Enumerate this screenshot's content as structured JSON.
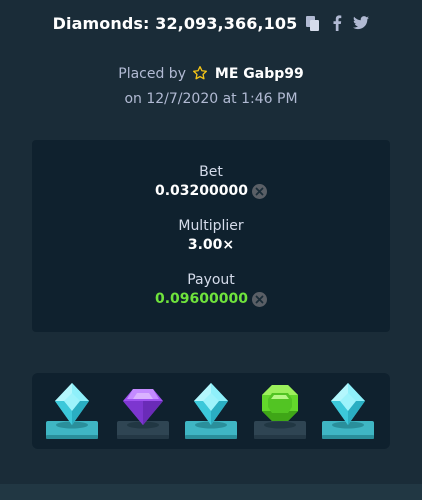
{
  "header": {
    "title": "Diamonds: 32,093,366,105",
    "actions": [
      "copy-icon",
      "facebook-icon",
      "twitter-icon"
    ]
  },
  "placement": {
    "prefix": "Placed by",
    "user": "ME Gabp99",
    "date_line": "on 12/7/2020 at 1:46 PM"
  },
  "stats": {
    "bet_label": "Bet",
    "bet_value": "0.03200000",
    "multiplier_label": "Multiplier",
    "multiplier_value": "3.00×",
    "payout_label": "Payout",
    "payout_value": "0.09600000"
  },
  "gems": [
    {
      "type": "diamond",
      "color": "#5ee1ef",
      "platform": "#3fb6c4"
    },
    {
      "type": "amethyst",
      "color": "#9f52f0",
      "platform": "#2f4553"
    },
    {
      "type": "diamond",
      "color": "#5ee1ef",
      "platform": "#3fb6c4"
    },
    {
      "type": "emerald",
      "color": "#63d72b",
      "platform": "#2f4553"
    },
    {
      "type": "diamond",
      "color": "#5ee1ef",
      "platform": "#3fb6c4"
    }
  ],
  "colors": {
    "background": "#1a2c38",
    "card": "#0f212e",
    "payout_green": "#6fe33c",
    "star_gold": "#f5c518"
  }
}
